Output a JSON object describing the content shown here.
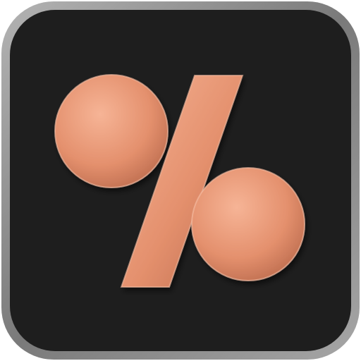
{
  "icon": {
    "name": "percent-sign-app-icon",
    "glyph": "percent",
    "colors": {
      "tile_background": "#1e1e1e",
      "tile_border": "#8f8f8f",
      "accent": "#e4906d",
      "accent_light": "#f6b496",
      "accent_dark": "#b9694c"
    }
  }
}
